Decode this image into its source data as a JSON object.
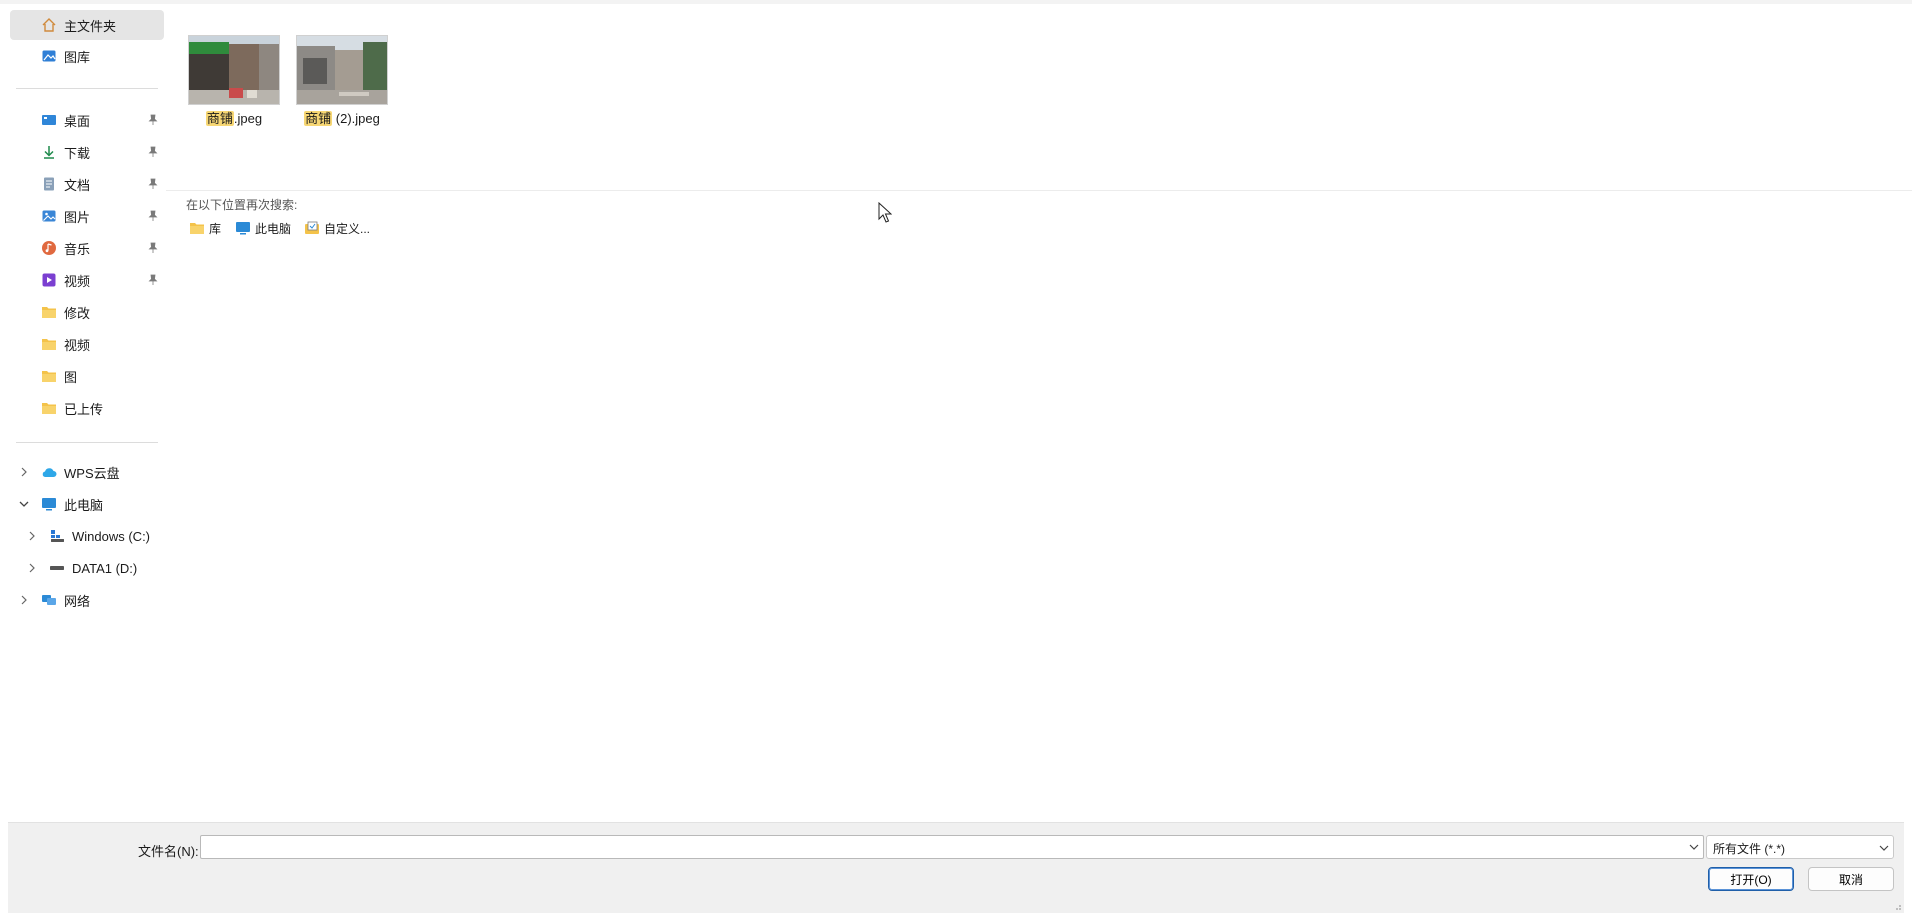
{
  "sidebar": {
    "items": [
      {
        "label": "主文件夹",
        "icon": "home-icon",
        "selected": true
      },
      {
        "label": "图库",
        "icon": "gallery-icon"
      },
      {
        "label": "桌面",
        "icon": "desktop-icon",
        "pinned": true
      },
      {
        "label": "下载",
        "icon": "download-icon",
        "pinned": true
      },
      {
        "label": "文档",
        "icon": "document-icon",
        "pinned": true
      },
      {
        "label": "图片",
        "icon": "pictures-icon",
        "pinned": true
      },
      {
        "label": "音乐",
        "icon": "music-icon",
        "pinned": true
      },
      {
        "label": "视频",
        "icon": "videos-icon",
        "pinned": true
      },
      {
        "label": "修改",
        "icon": "folder-icon"
      },
      {
        "label": "视频",
        "icon": "folder-icon"
      },
      {
        "label": "图",
        "icon": "folder-icon"
      },
      {
        "label": "已上传",
        "icon": "folder-icon"
      }
    ],
    "tree": [
      {
        "label": "WPS云盘",
        "icon": "cloud-icon",
        "expanded": false
      },
      {
        "label": "此电脑",
        "icon": "computer-icon",
        "expanded": true
      },
      {
        "label": "Windows (C:)",
        "icon": "windows-drive-icon",
        "expanded": false
      },
      {
        "label": "DATA1 (D:)",
        "icon": "drive-icon",
        "expanded": false
      },
      {
        "label": "网络",
        "icon": "network-icon",
        "expanded": false
      }
    ]
  },
  "results": {
    "files": [
      {
        "highlight": "商铺",
        "rest": ".jpeg"
      },
      {
        "highlight": "商铺",
        "rest": " (2).jpeg"
      }
    ],
    "search_again_label": "在以下位置再次搜索:",
    "locations": [
      {
        "label": "库",
        "icon": "library-folder-icon"
      },
      {
        "label": "此电脑",
        "icon": "computer-icon"
      },
      {
        "label": "自定义...",
        "icon": "custom-location-icon"
      }
    ]
  },
  "bottom": {
    "filename_label": "文件名(N):",
    "filename_value": "",
    "filetype": "所有文件 (*.*)",
    "open_label": "打开(O)",
    "cancel_label": "取消"
  },
  "colors": {
    "selected_bg": "#e5e5e5",
    "highlight": "#f7d774",
    "primary_border": "#1f5fa9",
    "bottom_bg": "#f0f0f0"
  }
}
